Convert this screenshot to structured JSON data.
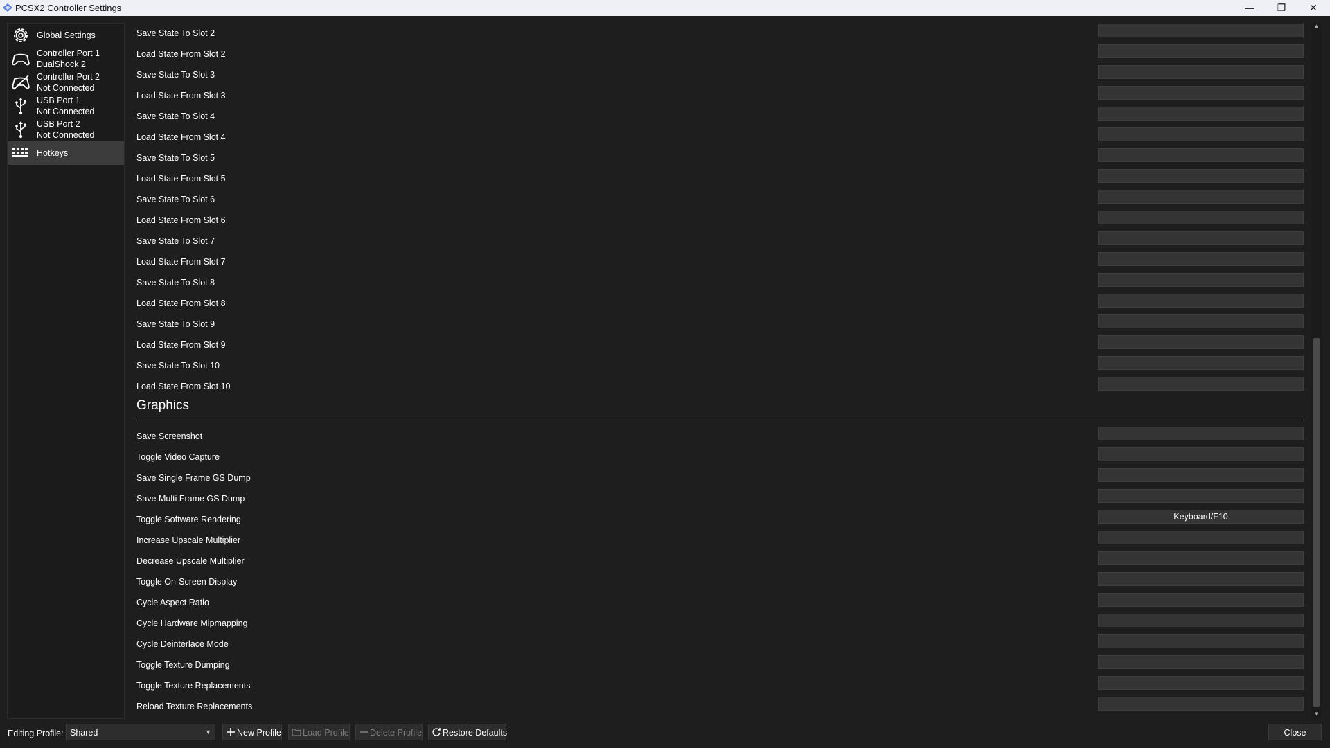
{
  "window": {
    "title": "PCSX2 Controller Settings"
  },
  "sidebar": {
    "items": [
      {
        "line1": "Global Settings",
        "icon": "gear-icon"
      },
      {
        "line1": "Controller Port 1",
        "line2": "DualShock 2",
        "icon": "gamepad-icon"
      },
      {
        "line1": "Controller Port 2",
        "line2": "Not Connected",
        "icon": "gamepad-off-icon"
      },
      {
        "line1": "USB Port 1",
        "line2": "Not Connected",
        "icon": "usb-icon"
      },
      {
        "line1": "USB Port 2",
        "line2": "Not Connected",
        "icon": "usb-icon"
      },
      {
        "line1": "Hotkeys",
        "icon": "keyboard-icon",
        "active": true
      }
    ]
  },
  "save_states": [
    {
      "label": "Save State To Slot 2",
      "binding": ""
    },
    {
      "label": "Load State From Slot 2",
      "binding": ""
    },
    {
      "label": "Save State To Slot 3",
      "binding": ""
    },
    {
      "label": "Load State From Slot 3",
      "binding": ""
    },
    {
      "label": "Save State To Slot 4",
      "binding": ""
    },
    {
      "label": "Load State From Slot 4",
      "binding": ""
    },
    {
      "label": "Save State To Slot 5",
      "binding": ""
    },
    {
      "label": "Load State From Slot 5",
      "binding": ""
    },
    {
      "label": "Save State To Slot 6",
      "binding": ""
    },
    {
      "label": "Load State From Slot 6",
      "binding": ""
    },
    {
      "label": "Save State To Slot 7",
      "binding": ""
    },
    {
      "label": "Load State From Slot 7",
      "binding": ""
    },
    {
      "label": "Save State To Slot 8",
      "binding": ""
    },
    {
      "label": "Load State From Slot 8",
      "binding": ""
    },
    {
      "label": "Save State To Slot 9",
      "binding": ""
    },
    {
      "label": "Load State From Slot 9",
      "binding": ""
    },
    {
      "label": "Save State To Slot 10",
      "binding": ""
    },
    {
      "label": "Load State From Slot 10",
      "binding": ""
    }
  ],
  "graphics": {
    "title": "Graphics",
    "rows": [
      {
        "label": "Save Screenshot",
        "binding": ""
      },
      {
        "label": "Toggle Video Capture",
        "binding": ""
      },
      {
        "label": "Save Single Frame GS Dump",
        "binding": ""
      },
      {
        "label": "Save Multi Frame GS Dump",
        "binding": ""
      },
      {
        "label": "Toggle Software Rendering",
        "binding": "Keyboard/F10"
      },
      {
        "label": "Increase Upscale Multiplier",
        "binding": ""
      },
      {
        "label": "Decrease Upscale Multiplier",
        "binding": ""
      },
      {
        "label": "Toggle On-Screen Display",
        "binding": ""
      },
      {
        "label": "Cycle Aspect Ratio",
        "binding": ""
      },
      {
        "label": "Cycle Hardware Mipmapping",
        "binding": ""
      },
      {
        "label": "Cycle Deinterlace Mode",
        "binding": ""
      },
      {
        "label": "Toggle Texture Dumping",
        "binding": ""
      },
      {
        "label": "Toggle Texture Replacements",
        "binding": ""
      },
      {
        "label": "Reload Texture Replacements",
        "binding": ""
      }
    ]
  },
  "bottom": {
    "profile_label": "Editing Profile:",
    "profile_value": "Shared",
    "new_profile": "New Profile",
    "load_profile": "Load Profile",
    "delete_profile": "Delete Profile",
    "restore_defaults": "Restore Defaults",
    "close": "Close"
  },
  "colors": {
    "background": "#1e1e1e",
    "titlebar": "#eef0f5",
    "active_nav": "#3c3c3c",
    "binding_box": "#343434"
  }
}
